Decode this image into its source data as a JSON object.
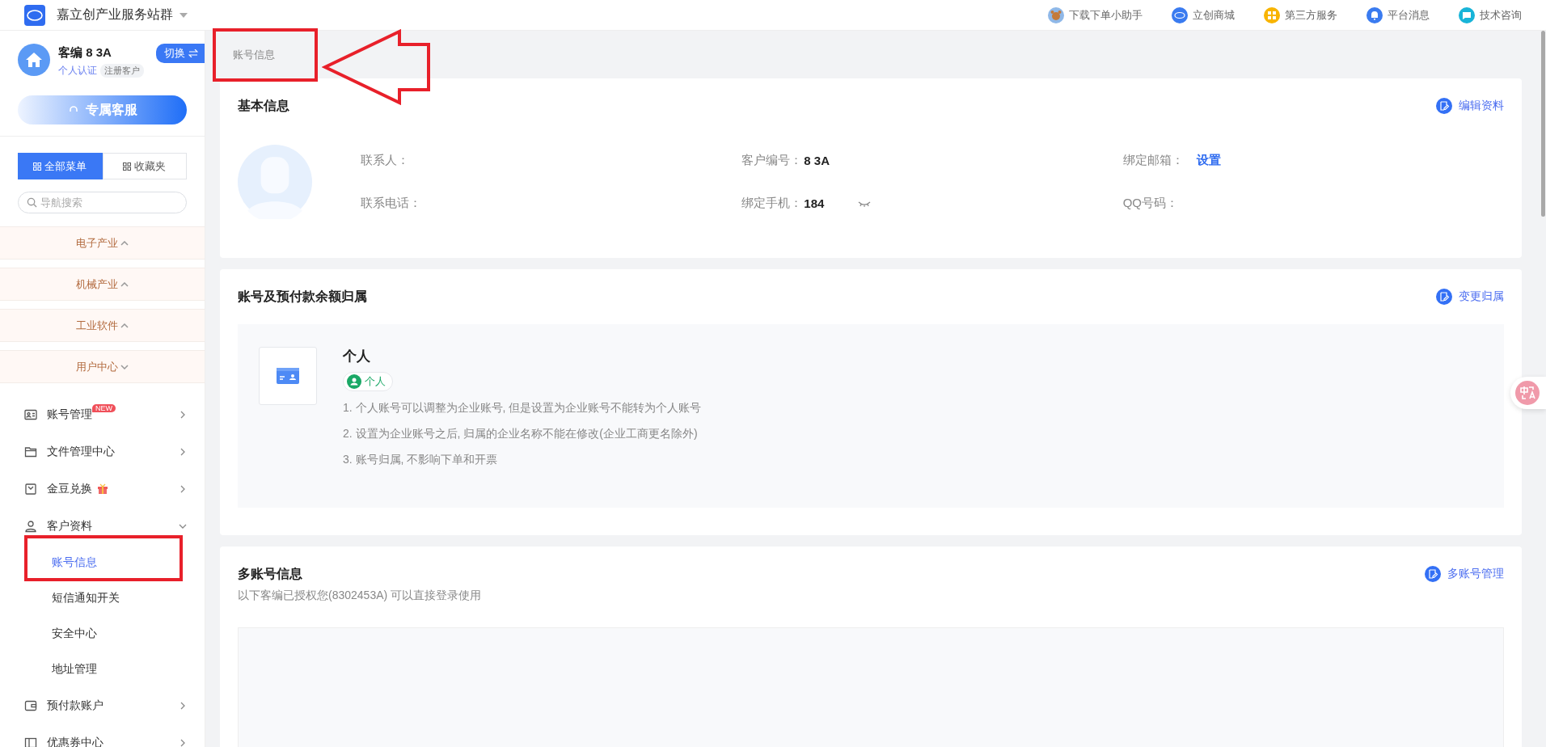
{
  "topbar": {
    "site_name": "嘉立创产业服务站群",
    "links": [
      {
        "label": "下载下单小助手"
      },
      {
        "label": "立创商城"
      },
      {
        "label": "第三方服务"
      },
      {
        "label": "平台消息"
      },
      {
        "label": "技术咨询"
      }
    ]
  },
  "sidebar": {
    "user": {
      "code": "客编 8 3A",
      "switch_label": "切换",
      "verification": "个人认证",
      "tag": "注册客户"
    },
    "service_button": "专属客服",
    "tabs": [
      {
        "label": "全部菜单",
        "selected": true
      },
      {
        "label": "收藏夹",
        "selected": false
      }
    ],
    "search": {
      "placeholder": "导航搜索"
    },
    "sections": [
      {
        "label": "电子产业",
        "expanded": false
      },
      {
        "label": "机械产业",
        "expanded": false
      },
      {
        "label": "工业软件",
        "expanded": false
      },
      {
        "label": "用户中心",
        "expanded": true
      }
    ],
    "menu": [
      {
        "label": "账号管理",
        "badge": "NEW",
        "expanded": false
      },
      {
        "label": "文件管理中心",
        "expanded": false
      },
      {
        "label": "金豆兑换",
        "expanded": false
      },
      {
        "label": "客户资料",
        "expanded": true,
        "children": [
          {
            "label": "账号信息",
            "selected": true
          },
          {
            "label": "短信通知开关",
            "selected": false
          },
          {
            "label": "安全中心",
            "selected": false
          },
          {
            "label": "地址管理",
            "selected": false
          }
        ]
      },
      {
        "label": "预付款账户",
        "expanded": false
      },
      {
        "label": "优惠券中心",
        "expanded": false
      }
    ]
  },
  "breadcrumb": "账号信息",
  "basic_info": {
    "title": "基本信息",
    "action": "编辑资料",
    "fields": [
      {
        "label": "联系人："
      },
      {
        "label": "客户编号：",
        "value": "8 3A",
        "kind": "text"
      },
      {
        "label": "绑定邮箱：",
        "value": "设置",
        "kind": "link"
      },
      {
        "label": "联系电话："
      },
      {
        "label": "绑定手机：",
        "value": "184",
        "kind": "masked"
      },
      {
        "label": "QQ号码："
      }
    ]
  },
  "ownership": {
    "title": "账号及预付款余额归属",
    "action": "变更归属",
    "owner": "个人",
    "tag": "个人",
    "notes": [
      "1. 个人账号可以调整为企业账号, 但是设置为企业账号不能转为个人账号",
      "2. 设置为企业账号之后, 归属的企业名称不能在修改(企业工商更名除外)",
      "3. 账号归属, 不影响下单和开票"
    ]
  },
  "multi_account": {
    "title": "多账号信息",
    "action": "多账号管理",
    "subtitle": "以下客编已授权您(8302453A) 可以直接登录使用"
  }
}
